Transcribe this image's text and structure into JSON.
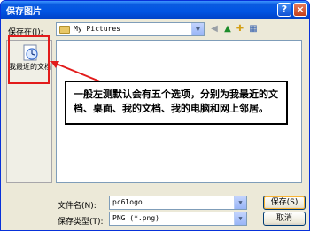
{
  "window": {
    "title": "保存图片",
    "help_glyph": "?",
    "close_glyph": "×"
  },
  "toolbar": {
    "save_in_label": "保存在(I):",
    "current_folder": "My Pictures",
    "dropdown_glyph": "▼",
    "back_glyph": "◀",
    "up_glyph": "▲",
    "new_folder_glyph": "✚",
    "views_glyph": "▦"
  },
  "places_bar": {
    "items": [
      {
        "label": "我最近的文档",
        "icon": "recent-documents-icon"
      }
    ]
  },
  "annotation": {
    "text": "一般左测默认会有五个选项，分别为我最近的文档、桌面、我的文档、我的电脑和网上邻居。"
  },
  "form": {
    "filename_label": "文件名(N):",
    "filename_value": "pc6logo",
    "filetype_label": "保存类型(T):",
    "filetype_value": "PNG (*.png)"
  },
  "buttons": {
    "save": "保存(S)",
    "cancel": "取消"
  },
  "colors": {
    "title_bar": "#0054e3",
    "highlight": "#e21b1b",
    "window_bg": "#ece9d8"
  }
}
